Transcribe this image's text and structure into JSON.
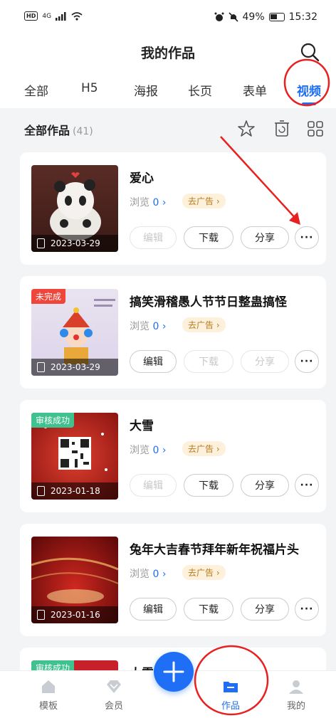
{
  "status_bar": {
    "left_badge": "HD",
    "network": "4G",
    "battery": "49%",
    "time": "15:32"
  },
  "header": {
    "title": "我的作品"
  },
  "tabs": [
    {
      "label": "全部"
    },
    {
      "label": "H5"
    },
    {
      "label": "海报"
    },
    {
      "label": "长页"
    },
    {
      "label": "表单"
    },
    {
      "label": "视频"
    }
  ],
  "section": {
    "title": "全部作品",
    "count": "(41)"
  },
  "cards": [
    {
      "title": "爱心",
      "date": "2023-03-29",
      "views_label": "浏览",
      "views": "0",
      "ad": "去广告",
      "status": "",
      "edit": "编辑",
      "download": "下载",
      "share": "分享",
      "more": "···"
    },
    {
      "title": "搞笑滑稽愚人节节日整蛊搞怪",
      "date": "2023-03-29",
      "views_label": "浏览",
      "views": "0",
      "ad": "去广告",
      "status": "未完成",
      "edit": "编辑",
      "download": "下载",
      "share": "分享",
      "more": "···"
    },
    {
      "title": "大雪",
      "date": "2023-01-18",
      "views_label": "浏览",
      "views": "0",
      "ad": "去广告",
      "status": "审核成功",
      "edit": "编辑",
      "download": "下载",
      "share": "分享",
      "more": "···"
    },
    {
      "title": "兔年大吉春节拜年新年祝福片头",
      "date": "2023-01-16",
      "views_label": "浏览",
      "views": "0",
      "ad": "去广告",
      "status": "",
      "edit": "编辑",
      "download": "下载",
      "share": "分享",
      "more": "···"
    },
    {
      "title": "大雪",
      "status": "审核成功"
    }
  ],
  "bottom_nav": [
    {
      "label": "模板"
    },
    {
      "label": "会员"
    },
    {
      "label": "作品"
    },
    {
      "label": "我的"
    }
  ],
  "colors": {
    "accent": "#1e6ff5",
    "annotation": "#e82020"
  }
}
